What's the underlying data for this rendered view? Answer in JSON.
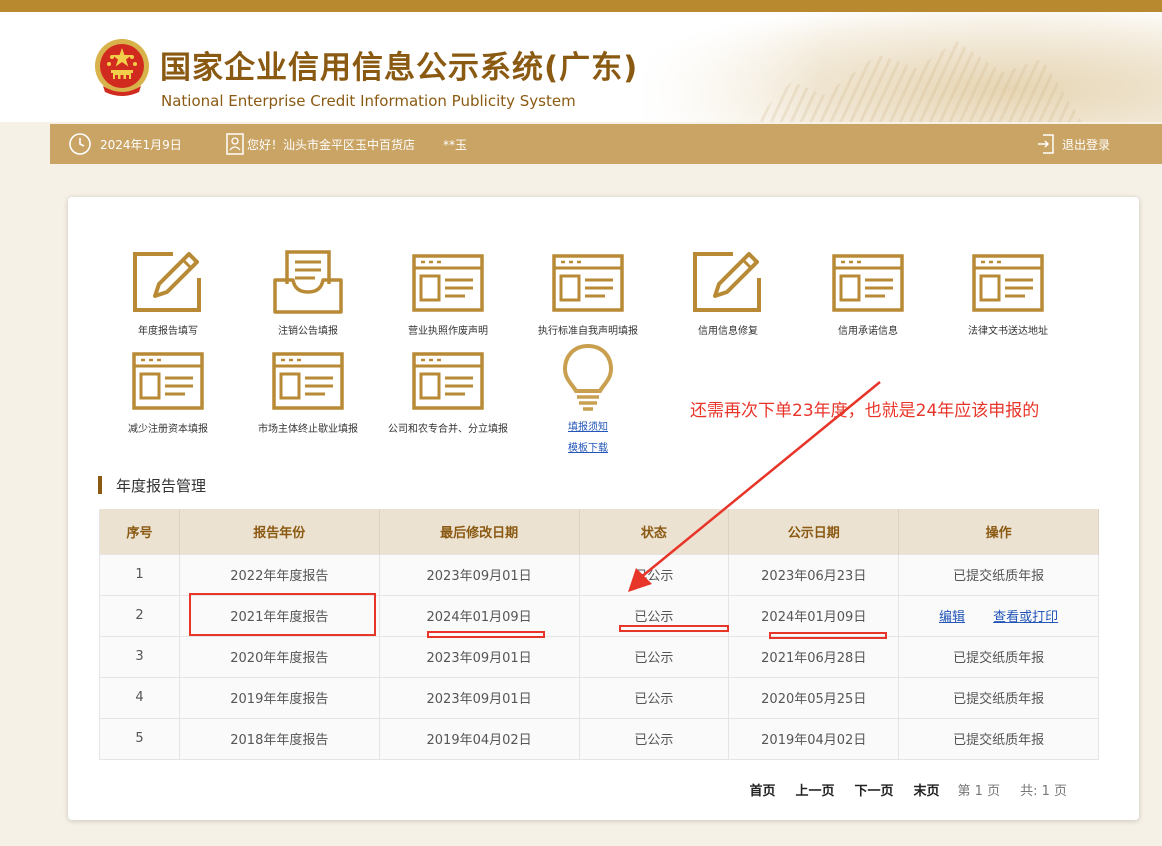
{
  "header": {
    "title_cn": "国家企业信用信息公示系统(广东)",
    "title_en": "National Enterprise Credit Information Publicity System"
  },
  "navbar": {
    "date": "2024年1月9日",
    "greeting": "您好！汕头市金平区玉中百货店",
    "user": "**玉",
    "logout": "退出登录"
  },
  "tiles": [
    {
      "label": "年度报告填写",
      "icon": "pencil-edit-icon"
    },
    {
      "label": "注销公告填报",
      "icon": "inbox-document-icon"
    },
    {
      "label": "营业执照作废声明",
      "icon": "form-window-icon"
    },
    {
      "label": "执行标准自我声明填报",
      "icon": "form-window-icon"
    },
    {
      "label": "信用信息修复",
      "icon": "pencil-edit-icon"
    },
    {
      "label": "信用承诺信息",
      "icon": "form-window-icon"
    },
    {
      "label": "法律文书送达地址",
      "icon": "form-window-icon"
    },
    {
      "label": "减少注册资本填报",
      "icon": "form-window-icon"
    },
    {
      "label": "市场主体终止歇业填报",
      "icon": "form-window-icon"
    },
    {
      "label": "公司和农专合并、分立填报",
      "icon": "form-window-icon"
    }
  ],
  "help": {
    "icon": "lightbulb-icon",
    "link1": "填报须知",
    "link2": "模板下载"
  },
  "section_title": "年度报告管理",
  "table": {
    "headers": [
      "序号",
      "报告年份",
      "最后修改日期",
      "状态",
      "公示日期",
      "操作"
    ],
    "rows": [
      {
        "no": "1",
        "year": "2022年年度报告",
        "modified": "2023年09月01日",
        "status": "已公示",
        "published": "2023年06月23日",
        "action": "已提交纸质年报"
      },
      {
        "no": "2",
        "year": "2021年年度报告",
        "modified": "2024年01月09日",
        "status": "已公示",
        "published": "2024年01月09日",
        "edit": "编辑",
        "view": "查看或打印"
      },
      {
        "no": "3",
        "year": "2020年年度报告",
        "modified": "2023年09月01日",
        "status": "已公示",
        "published": "2021年06月28日",
        "action": "已提交纸质年报"
      },
      {
        "no": "4",
        "year": "2019年年度报告",
        "modified": "2023年09月01日",
        "status": "已公示",
        "published": "2020年05月25日",
        "action": "已提交纸质年报"
      },
      {
        "no": "5",
        "year": "2018年年度报告",
        "modified": "2019年04月02日",
        "status": "已公示",
        "published": "2019年04月02日",
        "action": "已提交纸质年报"
      }
    ]
  },
  "pager": {
    "first": "首页",
    "prev": "上一页",
    "next": "下一页",
    "last": "末页",
    "page_info": "第 1 页",
    "total": "共:  1 页"
  },
  "annotation": {
    "text": "还需再次下单23年度，也就是24年应该申报的",
    "color": "#e8352a"
  },
  "colors": {
    "brand": "#8b5a12",
    "nav": "#c9a464",
    "link": "#2356b8"
  }
}
